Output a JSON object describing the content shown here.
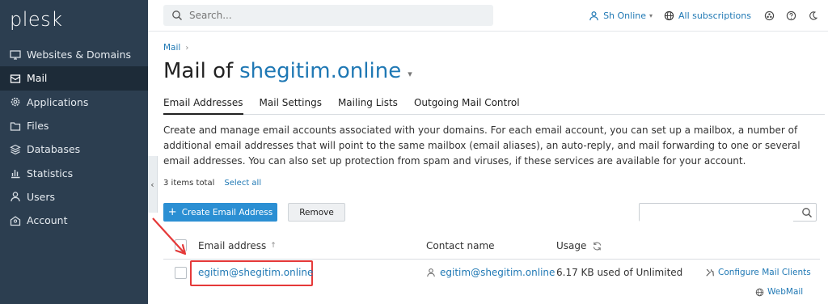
{
  "app": {
    "logo": "plesk"
  },
  "sidebar": {
    "items": [
      {
        "label": "Websites & Domains",
        "icon": "monitor-icon"
      },
      {
        "label": "Mail",
        "icon": "mail-icon",
        "active": true
      },
      {
        "label": "Applications",
        "icon": "gear-icon"
      },
      {
        "label": "Files",
        "icon": "folder-icon"
      },
      {
        "label": "Databases",
        "icon": "database-icon"
      },
      {
        "label": "Statistics",
        "icon": "bar-chart-icon"
      },
      {
        "label": "Users",
        "icon": "user-icon"
      },
      {
        "label": "Account",
        "icon": "account-icon"
      }
    ]
  },
  "topbar": {
    "search_placeholder": "Search...",
    "user_label": "Sh Online",
    "subscriptions_label": "All subscriptions"
  },
  "breadcrumb": {
    "item": "Mail",
    "separator": "›"
  },
  "page": {
    "title_prefix": "Mail of",
    "title_domain": "shegitim.online"
  },
  "tabs": [
    {
      "label": "Email Addresses",
      "active": true
    },
    {
      "label": "Mail Settings"
    },
    {
      "label": "Mailing Lists"
    },
    {
      "label": "Outgoing Mail Control"
    }
  ],
  "description": "Create and manage email accounts associated with your domains. For each email account, you can set up a mailbox, a number of additional email addresses that will point to the same mailbox (email aliases), an auto-reply, and mail forwarding to one or several email addresses. You can also set up protection from spam and viruses, if these services are available for your account.",
  "list": {
    "items_total": "3 items total",
    "select_all": "Select all",
    "create_button": "Create Email Address",
    "remove_button": "Remove"
  },
  "table": {
    "columns": {
      "email": "Email address",
      "email_sort": "↑",
      "contact": "Contact name",
      "usage": "Usage"
    },
    "rows": [
      {
        "email": "egitim@shegitim.online",
        "contact": "egitim@shegitim.online",
        "usage": "6.17 KB used of Unlimited",
        "configure": "Configure Mail Clients",
        "webmail": "WebMail"
      }
    ]
  },
  "colors": {
    "sidebar_bg": "#2c3e50",
    "accent": "#1f78b4",
    "primary_button": "#2b8fd3",
    "annotation": "#e53939"
  }
}
